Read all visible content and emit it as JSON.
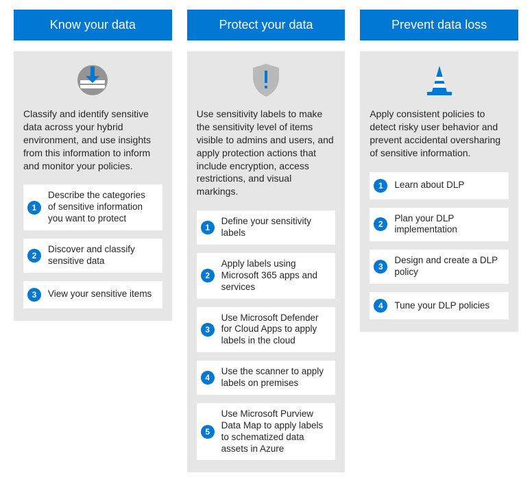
{
  "colors": {
    "accent": "#0078d4",
    "panel_bg": "#e6e6e6",
    "gray_icon": "#949494"
  },
  "columns": [
    {
      "title": "Know your data",
      "icon": "data-classify-icon",
      "description": "Classify and identify sensitive data across your hybrid environment, and use insights from this information to inform and monitor your policies.",
      "steps": [
        "Describe the categories of sensitive information you want to protect",
        "Discover and classify sensitive data",
        "View your sensitive items"
      ]
    },
    {
      "title": "Protect your data",
      "icon": "shield-alert-icon",
      "description": "Use sensitivity labels to make the sensitivity level of items visible to admins and users, and apply protection actions that include encryption, access restrictions, and visual markings.",
      "steps": [
        "Define your sensitivity labels",
        "Apply labels using Microsoft 365 apps and services",
        "Use Microsoft Defender for Cloud Apps to apply labels in the cloud",
        "Use the scanner to apply labels on premises",
        "Use Microsoft Purview Data Map to apply labels to schematized data assets in Azure"
      ]
    },
    {
      "title": "Prevent data loss",
      "icon": "traffic-cone-icon",
      "description": "Apply consistent policies to detect risky user behavior and prevent accidental oversharing of sensitive information.",
      "steps": [
        "Learn about DLP",
        "Plan your DLP implementation",
        "Design and create a DLP policy",
        "Tune your DLP policies"
      ]
    }
  ]
}
